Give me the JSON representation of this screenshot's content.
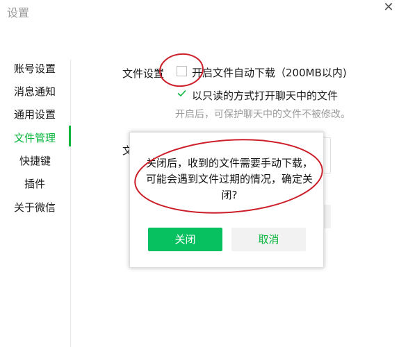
{
  "window": {
    "title": "设置",
    "close_glyph": "✕"
  },
  "sidebar": {
    "items": [
      {
        "label": "账号设置",
        "active": false
      },
      {
        "label": "消息通知",
        "active": false
      },
      {
        "label": "通用设置",
        "active": false
      },
      {
        "label": "文件管理",
        "active": true
      },
      {
        "label": "快捷键",
        "active": false
      },
      {
        "label": "插件",
        "active": false
      },
      {
        "label": "关于微信",
        "active": false
      }
    ]
  },
  "file_settings": {
    "section_label": "文件设置",
    "auto_download": {
      "label": "开启文件自动下载（200MB以内)",
      "checked": false
    },
    "read_only": {
      "label": "以只读的方式打开聊天中的文件",
      "checked": true
    },
    "hint": "开启后，可保护聊天中的文件不被修改。",
    "partial_label": "文"
  },
  "dialog": {
    "message": "关闭后，收到的文件需要手动下载，可能会遇到文件过期的情况，确定关闭?",
    "confirm_label": "关闭",
    "cancel_label": "取消"
  },
  "colors": {
    "accent": "#07c160",
    "annotation": "#cc1f2a"
  }
}
